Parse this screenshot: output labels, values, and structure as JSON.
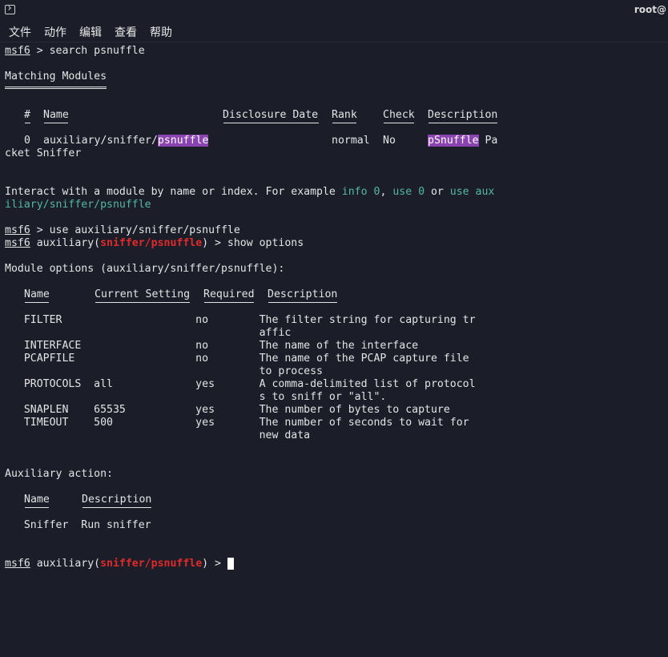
{
  "window": {
    "title": "root@"
  },
  "menu": [
    "文件",
    "动作",
    "编辑",
    "查看",
    "帮助"
  ],
  "prompt": "msf6",
  "cmd_search": " > search psnuffle",
  "matching_heading": "Matching Modules",
  "search_table": {
    "headers": [
      "#",
      "Name",
      "Disclosure Date",
      "Rank",
      "Check",
      "Description"
    ],
    "row": {
      "num": "0",
      "path_prefix": "auxiliary/sniffer/",
      "path_match": "psnuffle",
      "rank": "normal",
      "check": "No",
      "desc_match": "pSnuffle",
      "desc_rest_1": " Pa",
      "desc_rest_2": "cket Sniffer"
    }
  },
  "interact": {
    "pre": "Interact with a module by name or index. For example ",
    "ex1": "info 0",
    "sep1": ", ",
    "ex2": "use 0",
    "sep2": " or ",
    "ex3a": "use aux",
    "ex3b": "iliary/sniffer/psnuffle"
  },
  "cmd_use": " > use auxiliary/sniffer/psnuffle",
  "module_prefix": " auxiliary(",
  "module_name": "sniffer/psnuffle",
  "cmd_show_suffix": ") > show options",
  "prompt_end": ") > ",
  "options_heading": "Module options (auxiliary/sniffer/psnuffle):",
  "options_table": {
    "headers": [
      "Name",
      "Current Setting",
      "Required",
      "Description"
    ],
    "lines": [
      "   FILTER                     no        The filter string for capturing tr",
      "                                        affic",
      "   INTERFACE                  no        The name of the interface",
      "   PCAPFILE                   no        The name of the PCAP capture file",
      "                                        to process",
      "   PROTOCOLS  all             yes       A comma-delimited list of protocol",
      "                                        s to sniff or \"all\".",
      "   SNAPLEN    65535           yes       The number of bytes to capture",
      "   TIMEOUT    500             yes       The number of seconds to wait for",
      "                                        new data"
    ]
  },
  "action_heading": "Auxiliary action:",
  "action_table": {
    "headers": [
      "Name",
      "Description"
    ],
    "line": "   Sniffer  Run sniffer"
  }
}
